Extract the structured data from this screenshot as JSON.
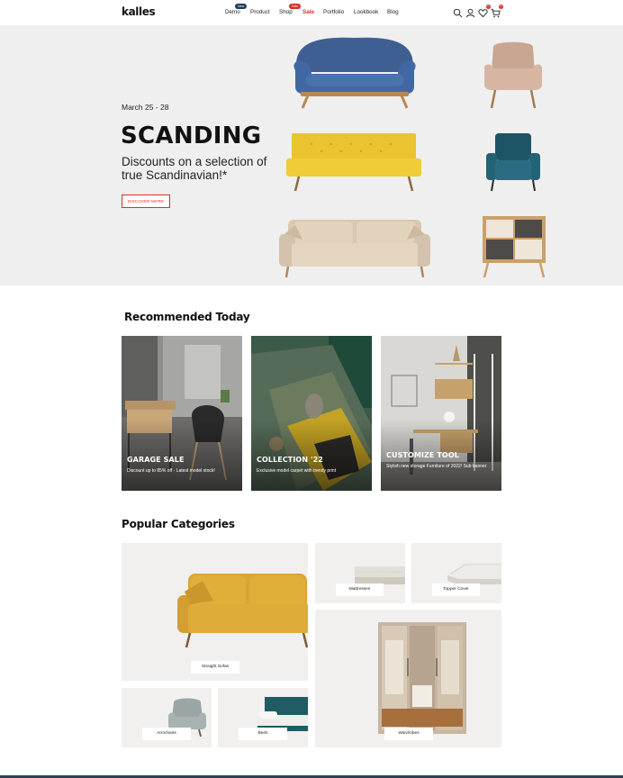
{
  "header": {
    "logo": "kalles",
    "nav": [
      {
        "label": "Demo",
        "badge": "New",
        "badge_color": "#1e3b5b"
      },
      {
        "label": "Product"
      },
      {
        "label": "Shop",
        "badge": "Sale",
        "badge_color": "#e02b2b"
      },
      {
        "label": "Sale"
      },
      {
        "label": "Portfolio"
      },
      {
        "label": "Lookbook"
      },
      {
        "label": "Blog"
      }
    ],
    "icons": [
      "search-icon",
      "user-icon",
      "wishlist-icon",
      "cart-icon"
    ],
    "wishlist_count": "0",
    "cart_count": "0"
  },
  "hero": {
    "date": "March 25 - 28",
    "title": "SCANDING",
    "subtitle": "Discounts on a selection of true Scandinavian!*",
    "button": "DISCOVER MORE",
    "background": "#efefef"
  },
  "recommended": {
    "title": "Recommended Today",
    "cards": [
      {
        "title": "GARAGE SALE",
        "desc": "Discount up to 85% off - Latest model stock!"
      },
      {
        "title": "COLLECTION '22",
        "desc": "Exclusive model carpet with trendy print"
      },
      {
        "title": "CUSTOMIZE TOOL",
        "desc": "Stylish new storage Furniture of 2022! Sub banner"
      }
    ]
  },
  "categories": {
    "title": "Popular Categories",
    "items": [
      {
        "label": "Straight Sofas"
      },
      {
        "label": "Mattresses"
      },
      {
        "label": "Topper Cover"
      },
      {
        "label": "Armchairs"
      },
      {
        "label": "Beds"
      },
      {
        "label": "Wardrobes"
      }
    ]
  },
  "colors": {
    "accent": "#e02b2b",
    "navy": "#1e3b5b",
    "footer": "#2d4257"
  }
}
